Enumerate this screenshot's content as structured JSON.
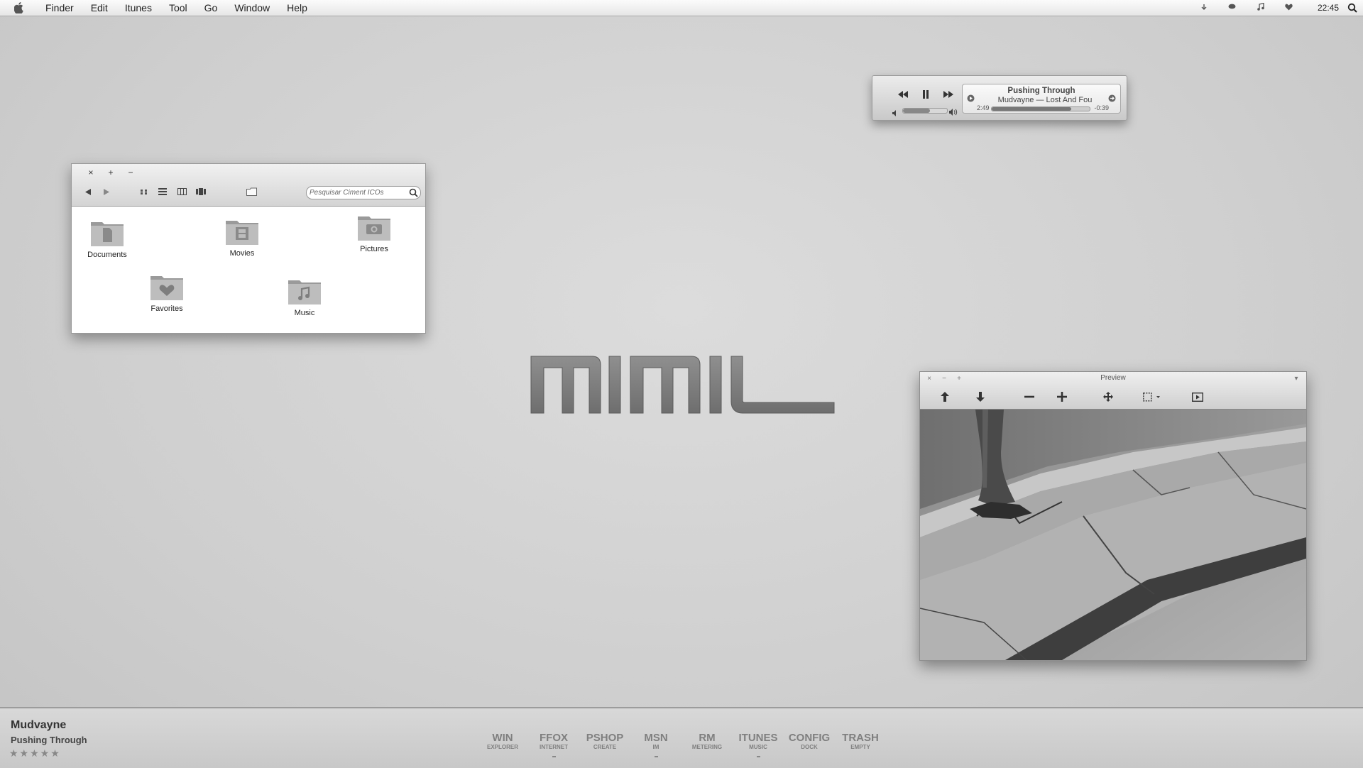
{
  "menubar": {
    "icon": "apple-icon",
    "items": [
      "Finder",
      "Edit",
      "Itunes",
      "Tool",
      "Go",
      "Window",
      "Help"
    ],
    "tray_icons": [
      "download-icon",
      "chat-icon",
      "music-note-icon",
      "heart-icon"
    ],
    "clock": "22:45",
    "spotlight_icon": "spotlight-icon"
  },
  "mini_player": {
    "title": "Pushing Through",
    "subtitle": "Mudvayne — Lost And Fou",
    "elapsed": "2:49",
    "remaining": "-0:39",
    "progress_fraction": 0.81,
    "volume_fraction": 0.62,
    "controls": [
      "rewind-icon",
      "pause-icon",
      "fast-forward-icon"
    ]
  },
  "finder": {
    "window_buttons": [
      "×",
      "+",
      "−"
    ],
    "search_placeholder": "Pesquisar Ciment ICOs",
    "folders": [
      {
        "label": "Documents",
        "icon": "document-folder-icon"
      },
      {
        "label": "Movies",
        "icon": "film-folder-icon"
      },
      {
        "label": "Pictures",
        "icon": "camera-folder-icon"
      },
      {
        "label": "Favorites",
        "icon": "heart-folder-icon"
      },
      {
        "label": "Music",
        "icon": "music-folder-icon"
      }
    ]
  },
  "preview": {
    "title": "Preview",
    "window_buttons": [
      "×",
      "−",
      "+"
    ],
    "menu_glyph": "▾",
    "tools": [
      "upload-icon",
      "download-icon",
      "zoom-out-icon",
      "zoom-in-icon",
      "move-icon",
      "select-icon",
      "slideshow-icon"
    ]
  },
  "dock": {
    "artist": "Mudvayne",
    "song": "Pushing Through",
    "rating": "★★★★★",
    "items": [
      {
        "big": "WIN",
        "small": "EXPLORER",
        "running": false
      },
      {
        "big": "FFOX",
        "small": "INTERNET",
        "running": true
      },
      {
        "big": "PSHOP",
        "small": "CREATE",
        "running": false
      },
      {
        "big": "MSN",
        "small": "IM",
        "running": true
      },
      {
        "big": "RM",
        "small": "METERING",
        "running": false
      },
      {
        "big": "ITUNES",
        "small": "MUSIC",
        "running": true
      },
      {
        "big": "CONFIG",
        "small": "DOCK",
        "running": false
      },
      {
        "big": "TRASH",
        "small": "EMPTY",
        "running": false
      }
    ]
  },
  "colors": {
    "wallpaper": "#d4d4d4",
    "accent": "#7f7f7f"
  }
}
